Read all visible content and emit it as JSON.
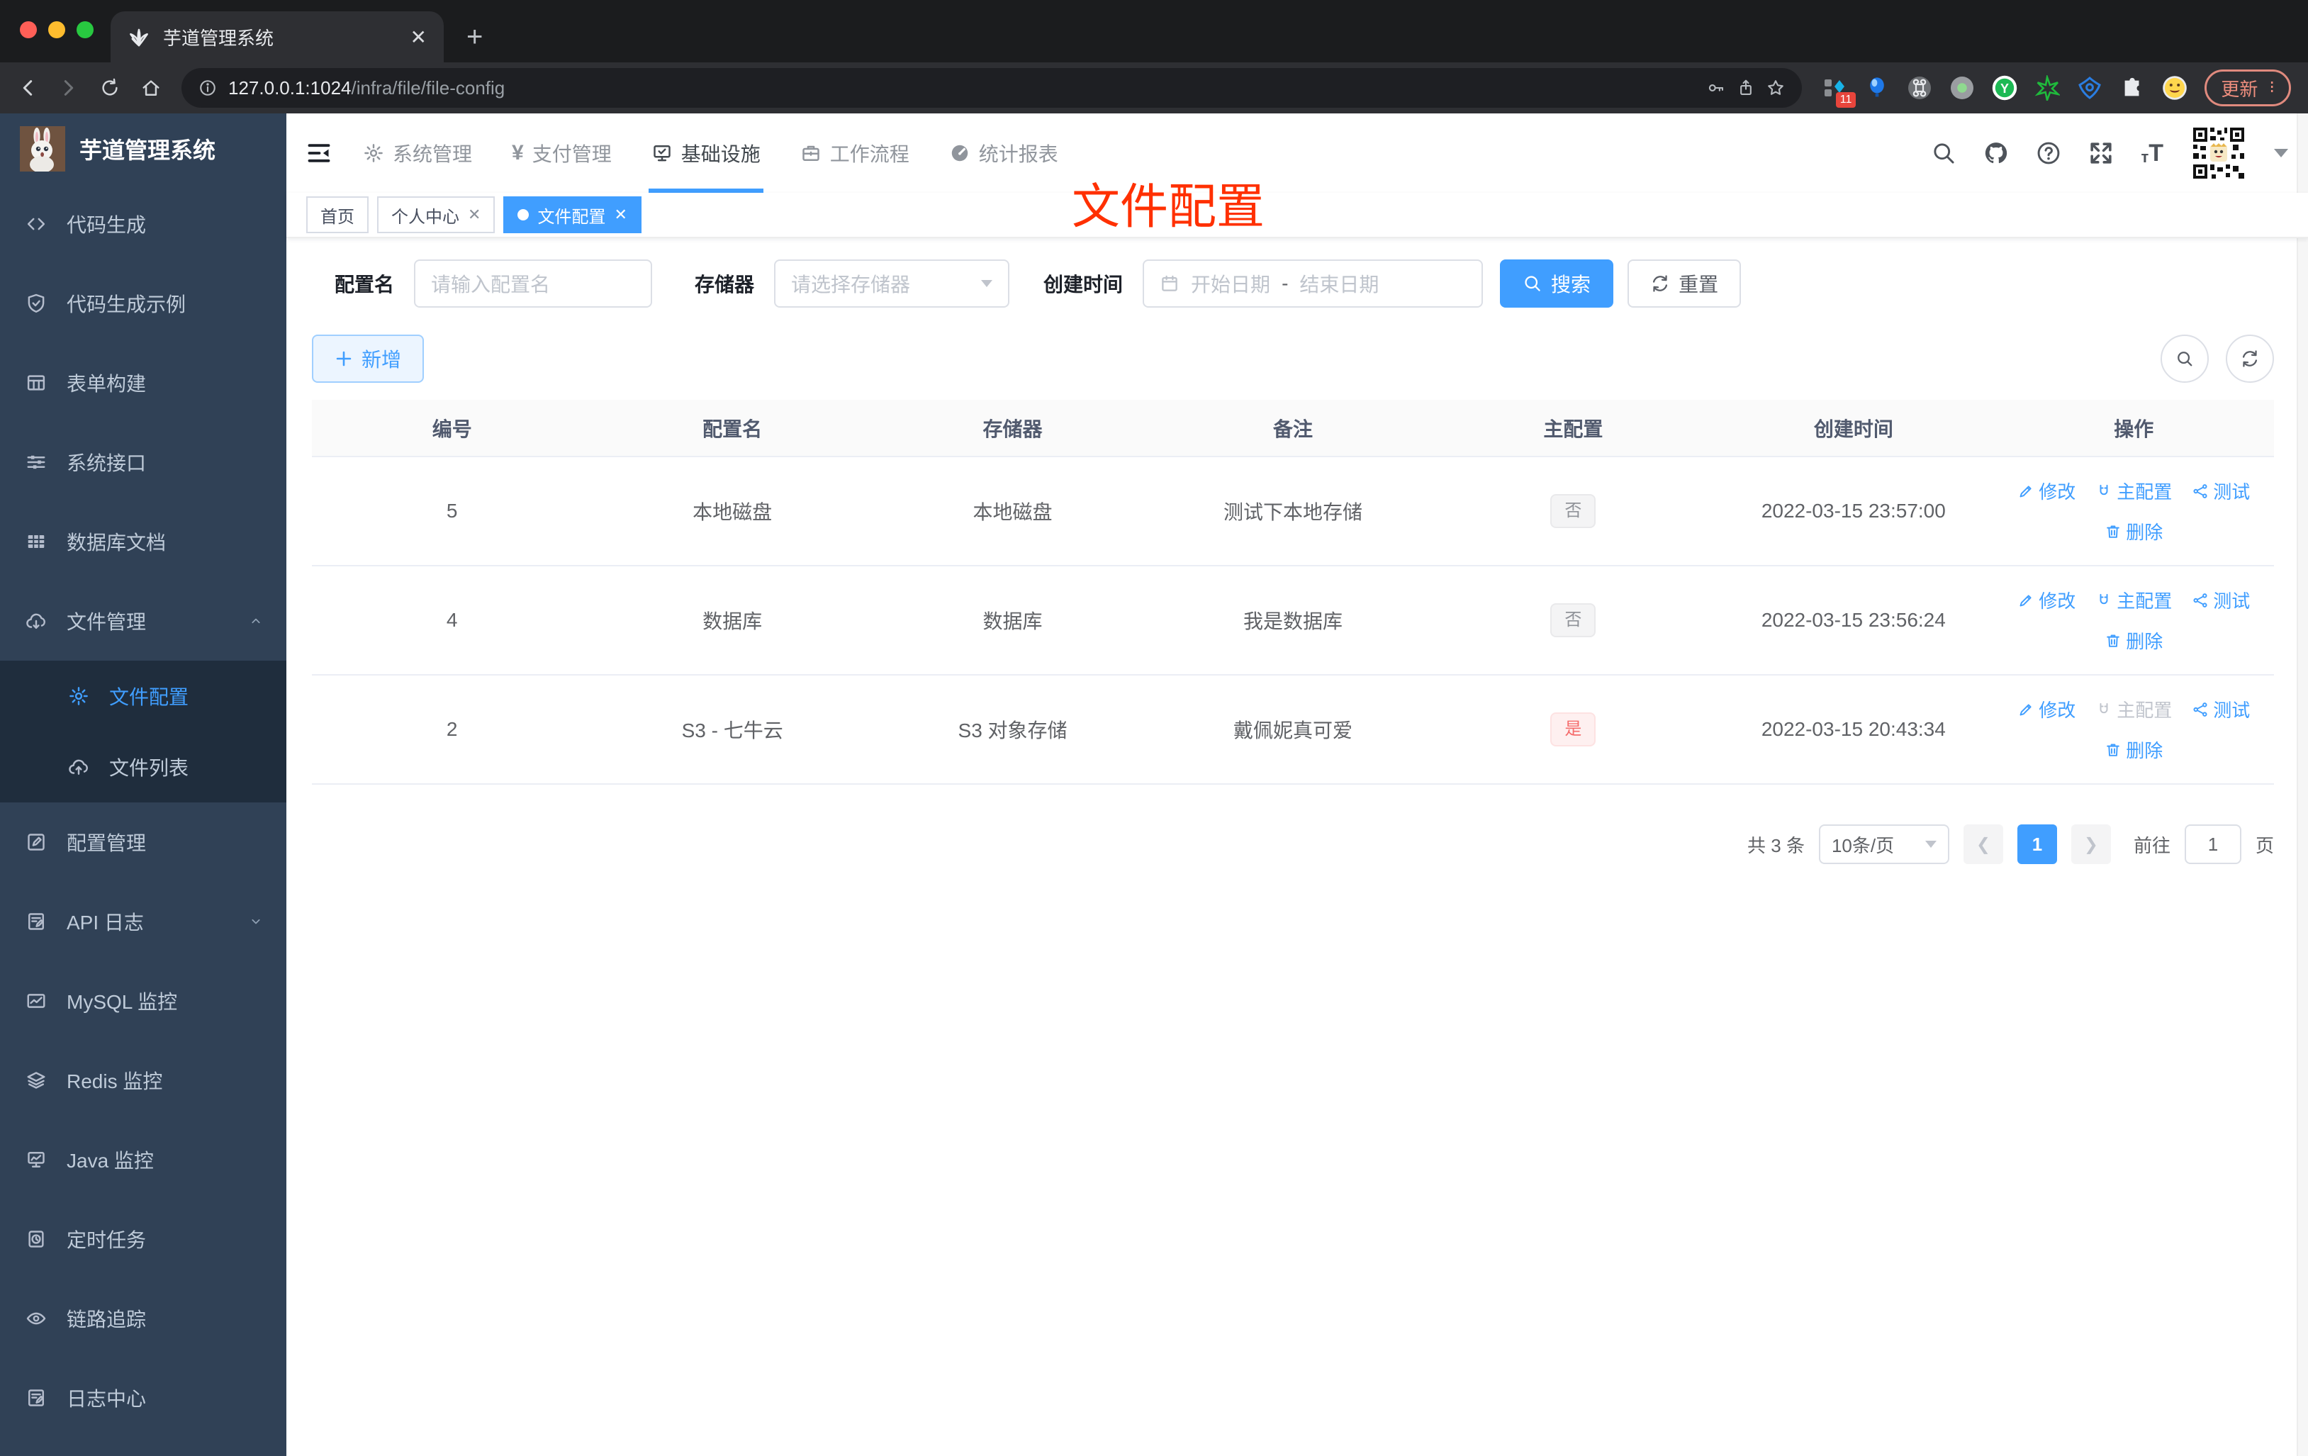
{
  "browser": {
    "tab_title": "芋道管理系统",
    "url_host": "127.0.0.1:1024",
    "url_path": "/infra/file/file-config",
    "update_label": "更新",
    "ext_badge": "11"
  },
  "sidebar": {
    "app_title": "芋道管理系统",
    "items": [
      {
        "label": "代码生成",
        "icon": "code"
      },
      {
        "label": "代码生成示例",
        "icon": "shield-check"
      },
      {
        "label": "表单构建",
        "icon": "form-grid"
      },
      {
        "label": "系统接口",
        "icon": "sliders"
      },
      {
        "label": "数据库文档",
        "icon": "table-filled"
      },
      {
        "label": "文件管理",
        "icon": "cloud-download",
        "expanded": true,
        "children": [
          {
            "label": "文件配置",
            "icon": "gear",
            "active": true
          },
          {
            "label": "文件列表",
            "icon": "cloud-upload"
          }
        ]
      },
      {
        "label": "配置管理",
        "icon": "edit-square"
      },
      {
        "label": "API 日志",
        "icon": "log-edit",
        "collapsed": true
      },
      {
        "label": "MySQL 监控",
        "icon": "chart"
      },
      {
        "label": "Redis 监控",
        "icon": "layers"
      },
      {
        "label": "Java 监控",
        "icon": "monitor"
      },
      {
        "label": "定时任务",
        "icon": "timer"
      },
      {
        "label": "链路追踪",
        "icon": "eye"
      },
      {
        "label": "日志中心",
        "icon": "log-edit"
      }
    ]
  },
  "topnav": {
    "items": [
      {
        "label": "系统管理",
        "icon": "gear"
      },
      {
        "label": "支付管理",
        "icon": "yen"
      },
      {
        "label": "基础设施",
        "icon": "monitor-check",
        "active": true
      },
      {
        "label": "工作流程",
        "icon": "briefcase"
      },
      {
        "label": "统计报表",
        "icon": "gauge"
      }
    ]
  },
  "tags": [
    {
      "label": "首页"
    },
    {
      "label": "个人中心",
      "closable": true
    },
    {
      "label": "文件配置",
      "closable": true,
      "active": true
    }
  ],
  "overlay_title": "文件配置",
  "filters": {
    "name_label": "配置名",
    "name_placeholder": "请输入配置名",
    "storage_label": "存储器",
    "storage_placeholder": "请选择存储器",
    "date_label": "创建时间",
    "date_start": "开始日期",
    "date_separator": "-",
    "date_end": "结束日期",
    "search_label": "搜索",
    "reset_label": "重置"
  },
  "toolbar": {
    "add_label": "新增"
  },
  "table": {
    "columns": [
      "编号",
      "配置名",
      "存储器",
      "备注",
      "主配置",
      "创建时间",
      "操作"
    ],
    "action_labels": {
      "edit": "修改",
      "master": "主配置",
      "test": "测试",
      "delete": "删除"
    },
    "rows": [
      {
        "id": "5",
        "name": "本地磁盘",
        "storage": "本地磁盘",
        "remark": "测试下本地存储",
        "master": "否",
        "master_type": "info",
        "created": "2022-03-15 23:57:00",
        "master_action_disabled": false
      },
      {
        "id": "4",
        "name": "数据库",
        "storage": "数据库",
        "remark": "我是数据库",
        "master": "否",
        "master_type": "info",
        "created": "2022-03-15 23:56:24",
        "master_action_disabled": false
      },
      {
        "id": "2",
        "name": "S3 - 七牛云",
        "storage": "S3 对象存储",
        "remark": "戴佩妮真可爱",
        "master": "是",
        "master_type": "danger",
        "created": "2022-03-15 20:43:34",
        "master_action_disabled": true
      }
    ]
  },
  "pagination": {
    "total_label": "共 3 条",
    "page_size": "10条/页",
    "current_page": "1",
    "goto_label": "前往",
    "goto_value": "1",
    "page_unit": "页"
  },
  "colors": {
    "accent": "#409eff",
    "danger": "#f56c6c",
    "overlay_red": "#ff3000",
    "sidebar_bg": "#304156",
    "submenu_bg": "#1f2d3d"
  }
}
